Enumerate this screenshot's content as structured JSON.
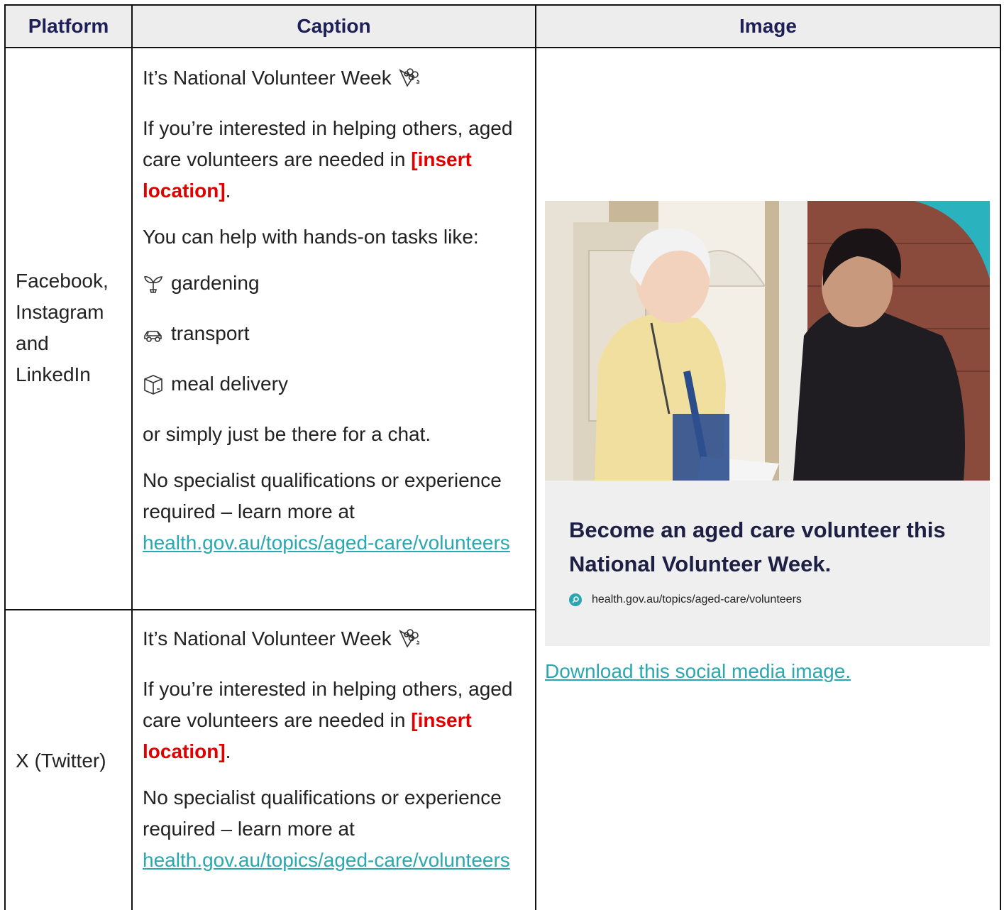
{
  "table": {
    "headers": [
      "Platform",
      "Caption",
      "Image"
    ],
    "rows": [
      {
        "platform": "Facebook, Instagram and LinkedIn",
        "platform_lines": [
          "Facebook,",
          "Instagram",
          "and",
          "LinkedIn"
        ],
        "caption": {
          "title": "It’s National Volunteer Week",
          "title_icon": "bouquet-icon",
          "intro_a": "If you’re interested in helping others, aged care volunteers are needed in ",
          "placeholder": "[insert location]",
          "intro_end": ".",
          "tasks_intro": "You can help with hands-on tasks like:",
          "tasks": [
            {
              "icon": "seedling-icon",
              "text": "gardening"
            },
            {
              "icon": "car-icon",
              "text": "transport"
            },
            {
              "icon": "package-icon",
              "text": "meal delivery"
            }
          ],
          "chat": "or simply just be there for a chat.",
          "closing": "No specialist qualifications or experience required – learn more at ",
          "link": "health.gov.au/topics/aged-care/volunteers"
        }
      },
      {
        "platform": "X (Twitter)",
        "caption": {
          "title": "It’s National Volunteer Week",
          "title_icon": "bouquet-icon",
          "intro_a": "If you’re interested in helping others, aged care volunteers are needed in ",
          "placeholder": "[insert location]",
          "intro_end": ".",
          "closing": "No specialist qualifications or experience required – learn more at ",
          "link": "health.gov.au/topics/aged-care/volunteers"
        }
      }
    ],
    "image_cell": {
      "card_title": "Become an aged care volunteer this National Volunteer Week.",
      "card_url": "health.gov.au/topics/aged-care/volunteers",
      "download_link": "Download this social media image."
    }
  },
  "colors": {
    "header_bg": "#ededed",
    "header_text": "#1e1f56",
    "link": "#2aa7b1",
    "placeholder": "#e00000",
    "card_bg": "#efeff0",
    "card_title": "#1e1f44"
  }
}
